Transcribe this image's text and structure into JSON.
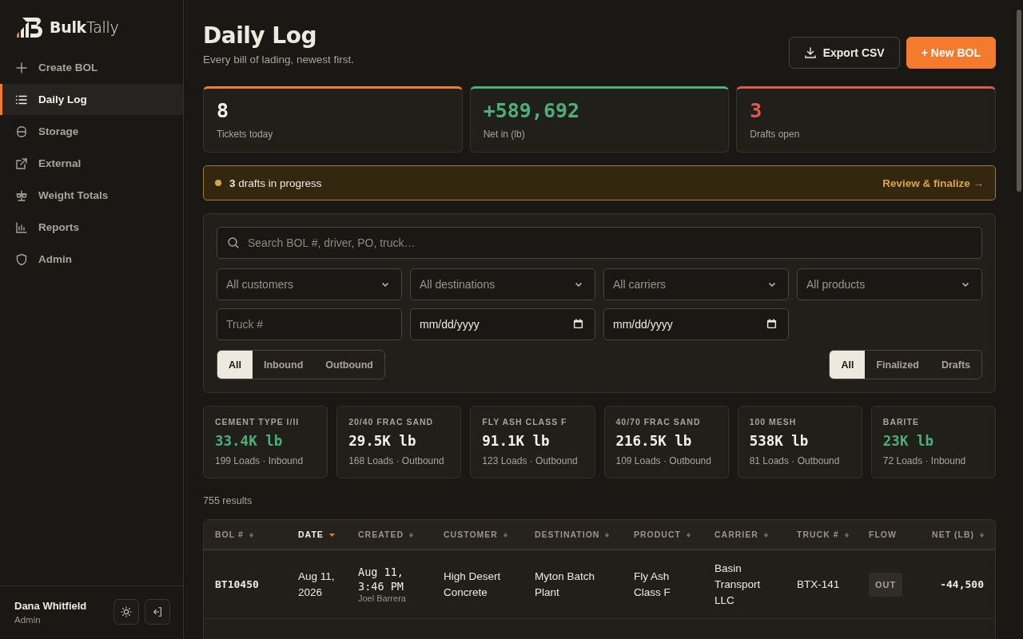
{
  "brand": {
    "bold": "Bulk",
    "light": "Tally"
  },
  "nav": [
    {
      "label": "Create BOL",
      "selected": false
    },
    {
      "label": "Daily Log",
      "selected": true
    },
    {
      "label": "Storage",
      "selected": false
    },
    {
      "label": "External",
      "selected": false
    },
    {
      "label": "Weight Totals",
      "selected": false
    },
    {
      "label": "Reports",
      "selected": false
    },
    {
      "label": "Admin",
      "selected": false
    }
  ],
  "user": {
    "name": "Dana Whitfield",
    "role": "Admin"
  },
  "header": {
    "title": "Daily Log",
    "subtitle": "Every bill of lading, newest first.",
    "export_label": "Export CSV",
    "new_label": "+ New BOL"
  },
  "stats": [
    {
      "value": "8",
      "label": "Tickets today",
      "tinted": false,
      "color": "#f47b2e"
    },
    {
      "value": "+589,692",
      "label": "Net in (lb)",
      "tinted": true,
      "color": "#4caf7a"
    },
    {
      "value": "3",
      "label": "Drafts open",
      "tinted": true,
      "color": "#e05a4f"
    }
  ],
  "banner": {
    "text": "**3** drafts in progress",
    "action": "Review & finalize →"
  },
  "filters": {
    "search_placeholder": "Search BOL #, driver, PO, truck…",
    "selects": [
      "All customers",
      "All destinations",
      "All carriers",
      "All products"
    ],
    "truck_placeholder": "Truck #",
    "date_placeholders": [
      "mm/dd/yyyy",
      "mm/dd/yyyy"
    ],
    "flow_tabs": [
      {
        "label": "All",
        "selected": true
      },
      {
        "label": "Inbound",
        "selected": false
      },
      {
        "label": "Outbound",
        "selected": false
      }
    ],
    "status_tabs": [
      {
        "label": "All",
        "selected": true
      },
      {
        "label": "Finalized",
        "selected": false
      },
      {
        "label": "Drafts",
        "selected": false
      }
    ]
  },
  "products": [
    {
      "name": "CEMENT TYPE I/II",
      "amount": "33.4K lb",
      "detail": "199 Loads · Inbound",
      "color": "#4caf7a"
    },
    {
      "name": "20/40 FRAC SAND",
      "amount": "29.5K lb",
      "detail": "168 Loads · Outbound",
      "color": "#f4f0e8"
    },
    {
      "name": "FLY ASH CLASS F",
      "amount": "91.1K lb",
      "detail": "123 Loads · Outbound",
      "color": "#f4f0e8"
    },
    {
      "name": "40/70 FRAC SAND",
      "amount": "216.5K lb",
      "detail": "109 Loads · Outbound",
      "color": "#f4f0e8"
    },
    {
      "name": "100 MESH",
      "amount": "538K lb",
      "detail": "81 Loads · Outbound",
      "color": "#f4f0e8"
    },
    {
      "name": "BARITE",
      "amount": "23K lb",
      "detail": "72 Loads · Inbound",
      "color": "#4caf7a"
    }
  ],
  "results": "755 results",
  "table": {
    "columns": [
      {
        "label": "BOL #",
        "sortable": true,
        "selected": false
      },
      {
        "label": "DATE",
        "sortable": true,
        "selected": true
      },
      {
        "label": "CREATED",
        "sortable": true,
        "selected": false
      },
      {
        "label": "CUSTOMER",
        "sortable": true,
        "selected": false
      },
      {
        "label": "DESTINATION",
        "sortable": true,
        "selected": false
      },
      {
        "label": "PRODUCT",
        "sortable": true,
        "selected": false
      },
      {
        "label": "CARRIER",
        "sortable": true,
        "selected": false
      },
      {
        "label": "TRUCK #",
        "sortable": true,
        "selected": false
      },
      {
        "label": "FLOW",
        "sortable": false,
        "selected": false
      },
      {
        "label": "NET (LB)",
        "sortable": true,
        "selected": false
      }
    ],
    "rows": [
      {
        "bol": "BT10450",
        "date": "Aug 11, 2026",
        "created": "Aug 11, 3:46 PM",
        "created_by": "Joel Barrera",
        "customer": "High Desert Concrete",
        "destination": "Myton Batch Plant",
        "product": "Fly Ash Class F",
        "carrier": "Basin Transport LLC",
        "truck": "BTX-141",
        "flow": "OUT",
        "net": "-44,500"
      }
    ]
  }
}
